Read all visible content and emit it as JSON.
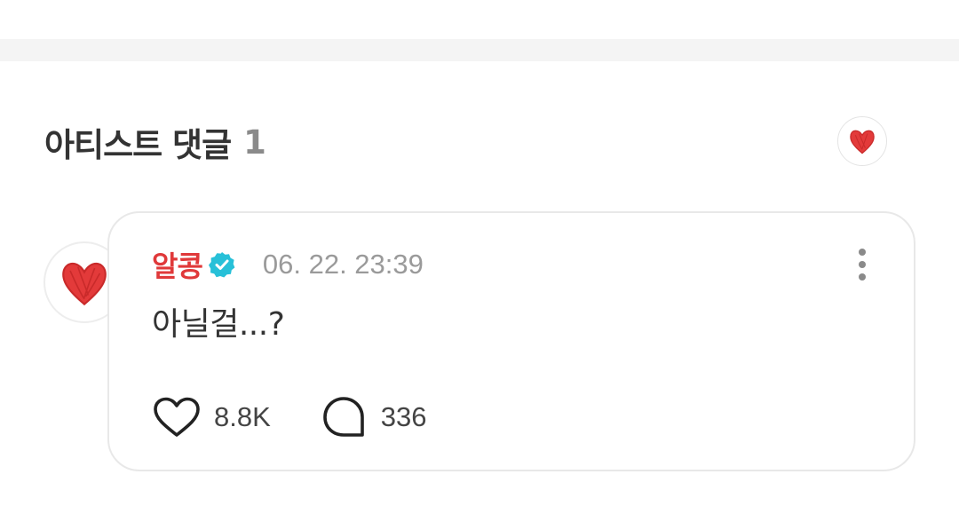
{
  "section": {
    "title": "아티스트 댓글",
    "count": "1"
  },
  "comment": {
    "author": "알콩",
    "timestamp": "06. 22. 23:39",
    "text": "아닐걸...?",
    "likes": "8.8K",
    "replies": "336"
  },
  "colors": {
    "author": "#e0393a",
    "verified": "#27c0d8",
    "heart": "#e33a3a",
    "card_border": "#e8e8e8",
    "top_band": "#f4f4f4"
  },
  "icons": {
    "badge": "red-heart-icon",
    "avatar": "red-heart-icon",
    "verified": "verified-check-icon",
    "more": "more-vertical-icon",
    "like": "heart-outline-icon",
    "reply": "speech-bubble-icon"
  }
}
